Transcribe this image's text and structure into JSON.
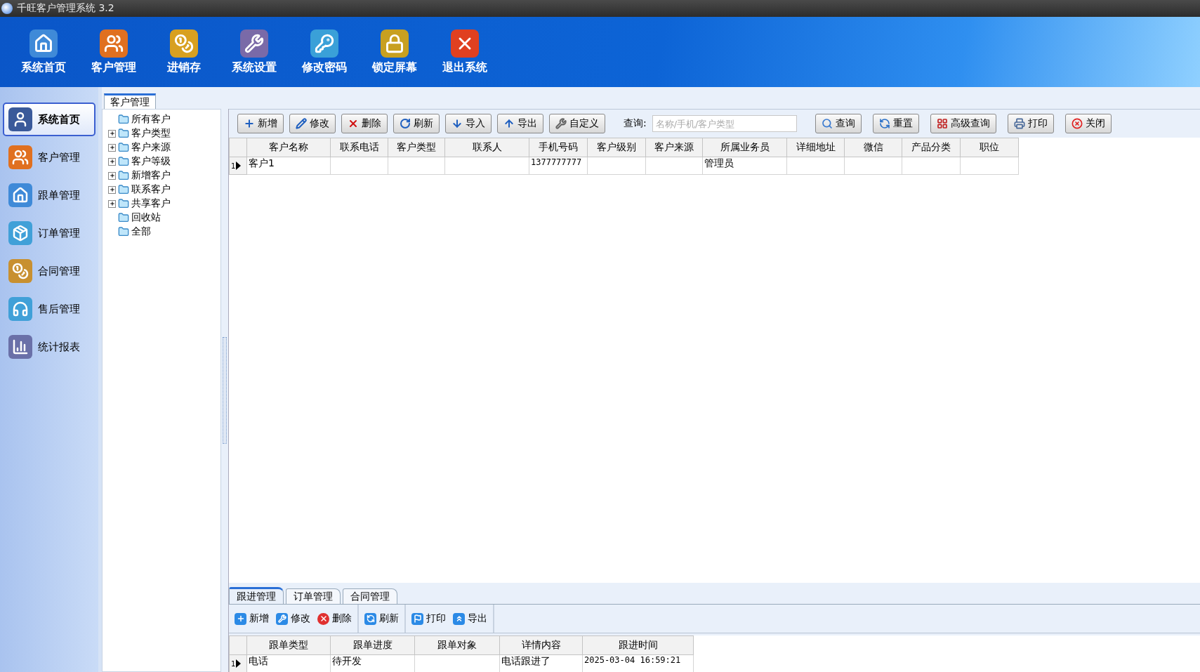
{
  "window": {
    "title": "千旺客户管理系统 3.2"
  },
  "nav": [
    {
      "label": "系统首页"
    },
    {
      "label": "客户管理"
    },
    {
      "label": "进销存"
    },
    {
      "label": "系统设置"
    },
    {
      "label": "修改密码"
    },
    {
      "label": "锁定屏幕"
    },
    {
      "label": "退出系统"
    }
  ],
  "sidebar": {
    "items": [
      {
        "label": "系统首页",
        "selected": true
      },
      {
        "label": "客户管理",
        "selected": false
      },
      {
        "label": "跟单管理",
        "selected": false
      },
      {
        "label": "订单管理",
        "selected": false
      },
      {
        "label": "合同管理",
        "selected": false
      },
      {
        "label": "售后管理",
        "selected": false
      },
      {
        "label": "统计报表",
        "selected": false
      }
    ]
  },
  "page_tabs": [
    {
      "label": "客户管理",
      "selected": true
    }
  ],
  "tree": [
    {
      "label": "所有客户",
      "collapsed": false
    },
    {
      "label": "客户类型",
      "collapsed": true
    },
    {
      "label": "客户来源",
      "collapsed": true
    },
    {
      "label": "客户等级",
      "collapsed": true
    },
    {
      "label": "新增客户",
      "collapsed": true
    },
    {
      "label": "联系客户",
      "collapsed": true
    },
    {
      "label": "共享客户",
      "collapsed": true
    },
    {
      "label": "回收站",
      "collapsed": false
    },
    {
      "label": "全部",
      "collapsed": false
    }
  ],
  "toolbar": {
    "buttons": [
      "新增",
      "修改",
      "删除",
      "刷新",
      "导入",
      "导出",
      "自定义"
    ],
    "search_label": "查询:",
    "search": {
      "placeholder": "名称/手机/客户类型"
    },
    "actions": [
      "查询",
      "重置",
      "高级查询",
      "打印",
      "关闭"
    ]
  },
  "table": {
    "columns": [
      "客户名称",
      "联系电话",
      "客户类型",
      "联系人",
      "手机号码",
      "客户级别",
      "客户来源",
      "所属业务员",
      "详细地址",
      "微信",
      "产品分类",
      "职位"
    ],
    "rows": [
      {
        "number": "1",
        "current": true,
        "cells": [
          "客户1",
          "",
          "",
          "",
          "1377777777",
          "",
          "",
          "管理员",
          "",
          "",
          "",
          ""
        ]
      }
    ]
  },
  "detail_tabs": [
    {
      "label": "跟进管理",
      "selected": true
    },
    {
      "label": "订单管理",
      "selected": false
    },
    {
      "label": "合同管理",
      "selected": false
    }
  ],
  "detail_toolbar": {
    "groups": [
      [
        "新增",
        "修改",
        "删除"
      ],
      [
        "刷新"
      ],
      [
        "打印",
        "导出"
      ]
    ]
  },
  "detail_table": {
    "columns": [
      "跟单类型",
      "跟单进度",
      "跟单对象",
      "详情内容",
      "跟进时间"
    ],
    "rows": [
      {
        "number": "1",
        "current": true,
        "cells": [
          "电话",
          "待开发",
          "",
          "电话跟进了",
          "2025-03-04 16:59:21"
        ]
      }
    ]
  }
}
